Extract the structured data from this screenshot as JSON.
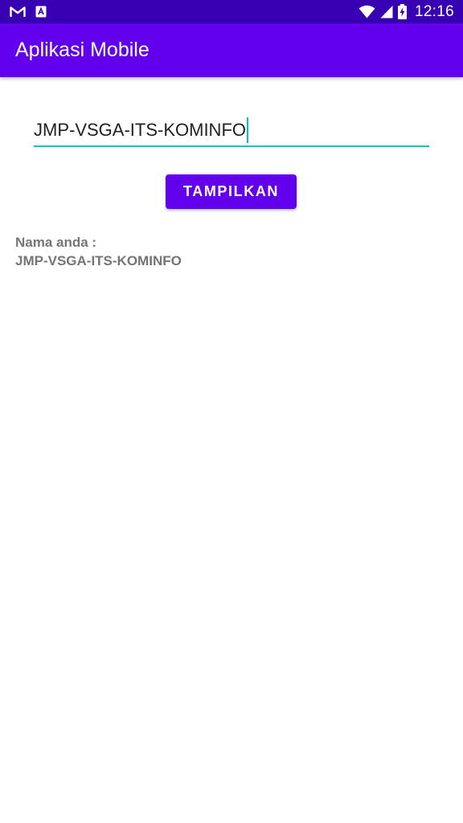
{
  "status_bar": {
    "time": "12:16",
    "left_icons": [
      "gmail-icon",
      "android-app-icon"
    ],
    "right_icons": [
      "wifi-icon",
      "signal-icon",
      "battery-charging-icon"
    ]
  },
  "app_bar": {
    "title": "Aplikasi Mobile"
  },
  "form": {
    "input_value": "JMP-VSGA-ITS-KOMINFO",
    "button_label": "TAMPILKAN"
  },
  "result": {
    "label": "Nama anda :",
    "value": "JMP-VSGA-ITS-KOMINFO"
  },
  "colors": {
    "status_bar": "#3700b3",
    "primary": "#6200ee",
    "accent": "#03c4b8",
    "result_text": "#757575"
  }
}
